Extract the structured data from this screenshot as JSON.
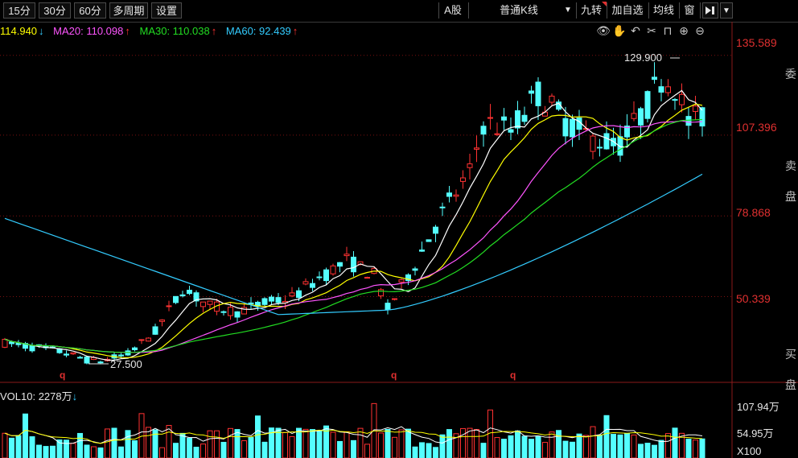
{
  "toolbar": {
    "periods": [
      "15分",
      "30分",
      "60分"
    ],
    "multi_period": "多周期",
    "settings": "设置",
    "market": "A股",
    "kline_type": "普通K线",
    "dropdown_glyph": "▼",
    "nine_turn": "九转",
    "add_watch": "加自选",
    "avg_line": "均线",
    "window": "窗"
  },
  "ma_legend": [
    {
      "text": "114.940",
      "arrow": "↓",
      "color": "#ffff00"
    },
    {
      "text": "MA20: 110.098",
      "arrow": "↑",
      "color": "#ff55ff"
    },
    {
      "text": "MA30: 110.038",
      "arrow": "↑",
      "color": "#22dd22"
    },
    {
      "text": "MA60: 92.439",
      "arrow": "↑",
      "color": "#33ccff"
    }
  ],
  "price_axis": {
    "labels": [
      "135.589",
      "107.396",
      "78.868",
      "50.339"
    ],
    "values": [
      135.589,
      107.396,
      78.868,
      50.339
    ],
    "min": 19.5,
    "max": 141.5
  },
  "annotations": {
    "high": "129.900",
    "low": "27.500",
    "q_marker": "q"
  },
  "side_panel": [
    "委",
    "卖",
    "盘",
    "买",
    "盘"
  ],
  "volume": {
    "header": "VOL10: 2278万",
    "header_arrow": "↓",
    "labels": [
      "107.94万",
      "54.95万",
      "X100"
    ]
  },
  "colors": {
    "up": "#ff3232",
    "down": "#54ffff",
    "ma5": "#ffffff",
    "ma10": "#ffff00",
    "ma20": "#ff55ff",
    "ma30": "#22dd22",
    "ma60": "#33ccff",
    "axis_text": "#e03030",
    "grid": "#7a1010"
  }
}
